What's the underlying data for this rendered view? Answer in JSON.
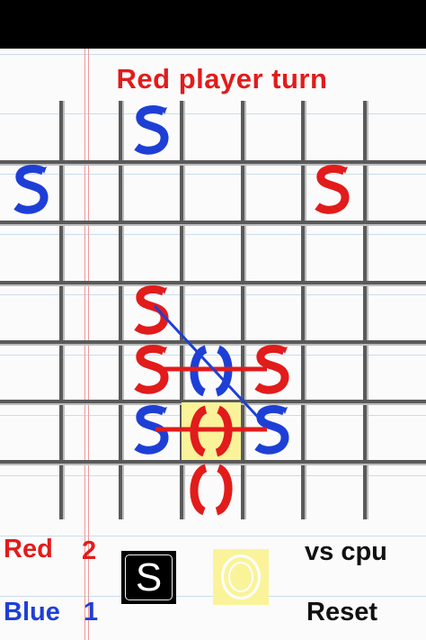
{
  "turn_text": "Red player turn",
  "colors": {
    "red": "#e21b1b",
    "blue": "#1e3fd6",
    "grid": "#5a5a5a",
    "selected": "#fbf39a"
  },
  "score": {
    "red": {
      "label": "Red",
      "value": "2"
    },
    "blue": {
      "label": "Blue",
      "value": "1"
    }
  },
  "controls": {
    "s_label": "S",
    "o_label": "O",
    "vs_cpu_label": "vs cpu",
    "reset_label": "Reset"
  },
  "board": {
    "size": "7x7",
    "pieces": [
      {
        "letter": "S",
        "player": "blue",
        "row": 0,
        "col": 2
      },
      {
        "letter": "S",
        "player": "blue",
        "row": 1,
        "col": 0
      },
      {
        "letter": "S",
        "player": "red",
        "row": 1,
        "col": 5
      },
      {
        "letter": "S",
        "player": "red",
        "row": 3,
        "col": 2
      },
      {
        "letter": "S",
        "player": "red",
        "row": 4,
        "col": 2
      },
      {
        "letter": "O",
        "player": "blue",
        "row": 4,
        "col": 3
      },
      {
        "letter": "S",
        "player": "red",
        "row": 4,
        "col": 4
      },
      {
        "letter": "S",
        "player": "blue",
        "row": 5,
        "col": 2
      },
      {
        "letter": "O",
        "player": "red",
        "row": 5,
        "col": 3
      },
      {
        "letter": "S",
        "player": "blue",
        "row": 5,
        "col": 4
      },
      {
        "letter": "O",
        "player": "red",
        "row": 6,
        "col": 3
      }
    ],
    "selected_cell": {
      "row": 5,
      "col": 3
    },
    "sos_lines": [
      {
        "player": "red",
        "from": {
          "row": 4,
          "col": 2
        },
        "to": {
          "row": 4,
          "col": 4
        }
      },
      {
        "player": "red",
        "from": {
          "row": 5,
          "col": 2
        },
        "to": {
          "row": 5,
          "col": 4
        }
      },
      {
        "player": "blue",
        "from": {
          "row": 3,
          "col": 2
        },
        "to": {
          "row": 5,
          "col": 4
        }
      }
    ]
  }
}
